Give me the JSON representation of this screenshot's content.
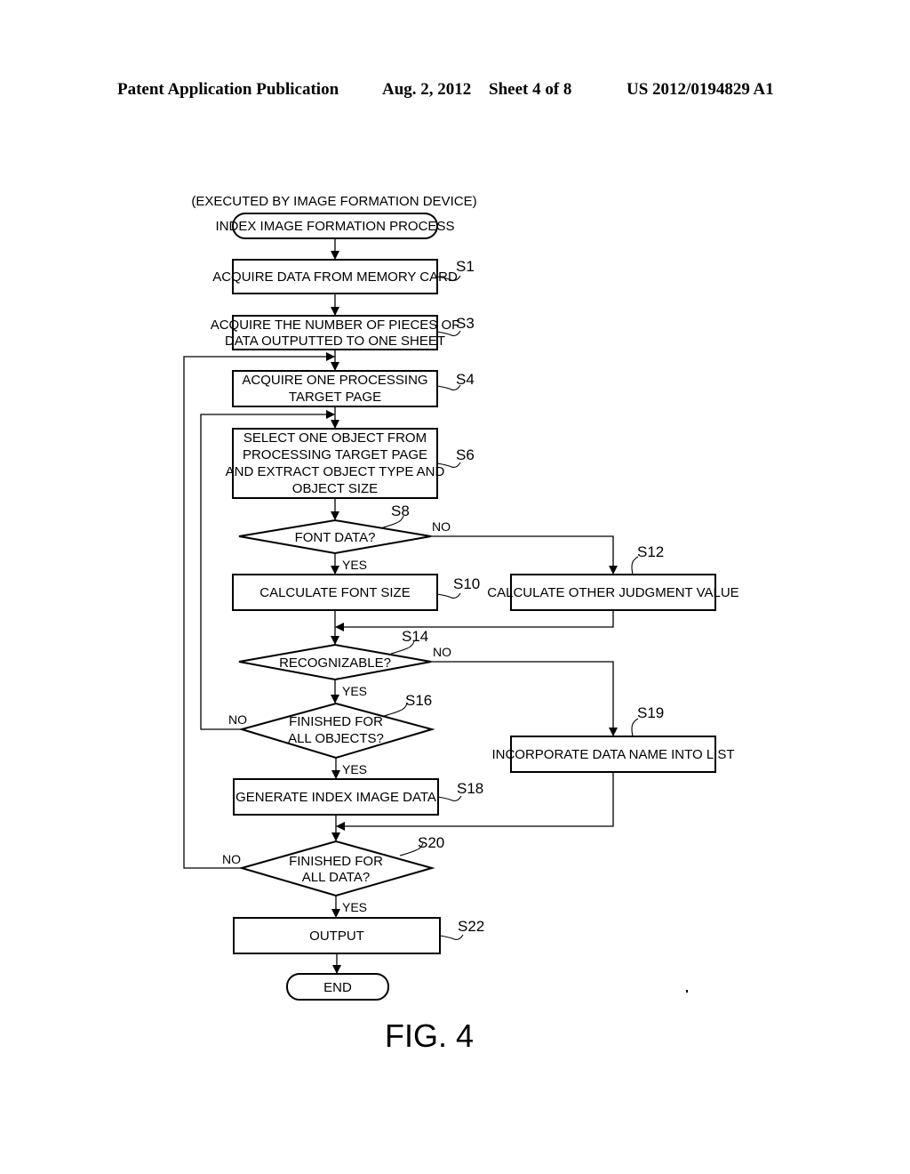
{
  "header": {
    "publication": "Patent Application Publication",
    "date": "Aug. 2, 2012",
    "sheet": "Sheet 4 of 8",
    "number": "US 2012/0194829 A1"
  },
  "figure": {
    "caption": "FIG. 4",
    "executor_note": "(EXECUTED BY IMAGE FORMATION DEVICE)",
    "start": "INDEX IMAGE FORMATION PROCESS",
    "end": "END",
    "steps": {
      "s1": {
        "id": "S1",
        "lines": [
          "ACQUIRE DATA FROM MEMORY CARD"
        ]
      },
      "s3": {
        "id": "S3",
        "lines": [
          "ACQUIRE THE NUMBER OF PIECES OF",
          "DATA OUTPUTTED TO ONE SHEET"
        ]
      },
      "s4": {
        "id": "S4",
        "lines": [
          "ACQUIRE ONE PROCESSING",
          "TARGET PAGE"
        ]
      },
      "s6": {
        "id": "S6",
        "lines": [
          "SELECT ONE OBJECT FROM",
          "PROCESSING TARGET PAGE",
          "AND EXTRACT OBJECT TYPE AND",
          "OBJECT SIZE"
        ]
      },
      "s8": {
        "id": "S8",
        "lines": [
          "FONT DATA?"
        ]
      },
      "s10": {
        "id": "S10",
        "lines": [
          "CALCULATE FONT SIZE"
        ]
      },
      "s12": {
        "id": "S12",
        "lines": [
          "CALCULATE OTHER JUDGMENT VALUE"
        ]
      },
      "s14": {
        "id": "S14",
        "lines": [
          "RECOGNIZABLE?"
        ]
      },
      "s16": {
        "id": "S16",
        "lines": [
          "FINISHED FOR",
          "ALL OBJECTS?"
        ]
      },
      "s18": {
        "id": "S18",
        "lines": [
          "GENERATE INDEX IMAGE DATA"
        ]
      },
      "s19": {
        "id": "S19",
        "lines": [
          "INCORPORATE DATA NAME INTO LIST"
        ]
      },
      "s20": {
        "id": "S20",
        "lines": [
          "FINISHED FOR",
          "ALL DATA?"
        ]
      },
      "s22": {
        "id": "S22",
        "lines": [
          "OUTPUT"
        ]
      }
    },
    "branch_labels": {
      "yes": "YES",
      "no": "NO"
    }
  }
}
